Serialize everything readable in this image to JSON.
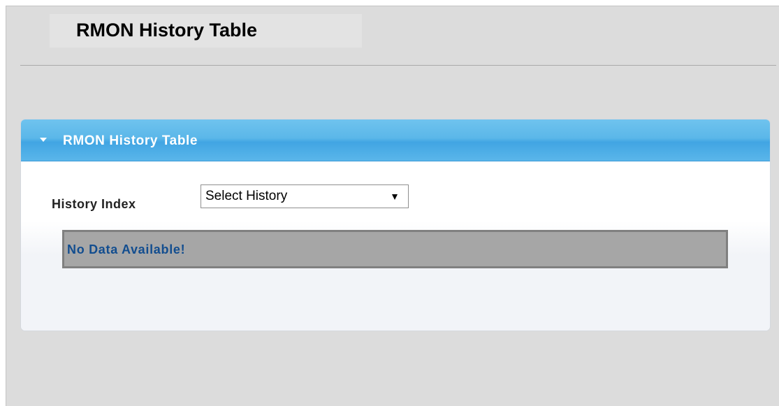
{
  "page": {
    "title": "RMON History Table"
  },
  "panel": {
    "title": "RMON History Table",
    "history_index_label": "History Index",
    "history_select": {
      "selected": "Select History"
    },
    "no_data_message": "No Data Available!"
  },
  "colors": {
    "page_background": "#dcdcdc",
    "panel_header": "#5bb7e9",
    "no_data_background": "#a6a6a6",
    "no_data_text": "#124d8f"
  },
  "icons": {
    "panel_toggle": "triangle-down-icon",
    "select_arrow": "chevron-down-icon"
  }
}
